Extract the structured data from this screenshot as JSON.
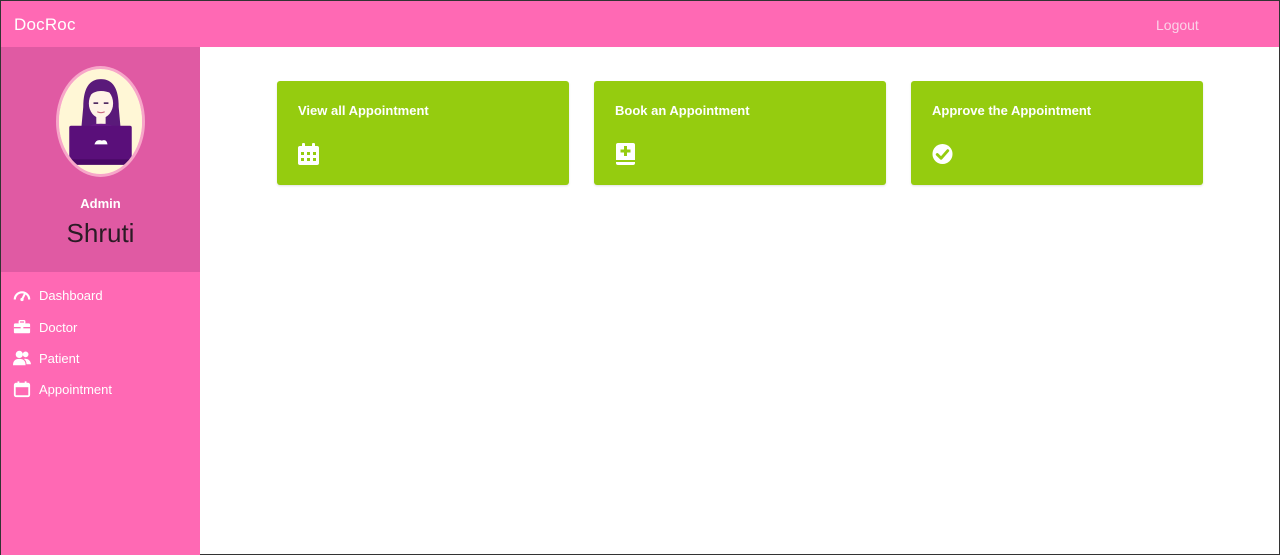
{
  "header": {
    "brand": "DocRoc",
    "logout_label": "Logout"
  },
  "profile": {
    "role": "Admin",
    "name": "Shruti",
    "avatar_icon": "woman-at-laptop-avatar"
  },
  "sidebar": {
    "items": [
      {
        "label": "Dashboard",
        "icon": "speedometer-icon"
      },
      {
        "label": "Doctor",
        "icon": "briefcase-icon"
      },
      {
        "label": "Patient",
        "icon": "users-icon"
      },
      {
        "label": "Appointment",
        "icon": "calendar-icon"
      }
    ]
  },
  "cards": [
    {
      "title": "View all Appointment",
      "icon": "calendar-grid-icon"
    },
    {
      "title": "Book an Appointment",
      "icon": "medical-book-icon"
    },
    {
      "title": "Approve the Appointment",
      "icon": "check-circle-icon"
    }
  ],
  "colors": {
    "header_bg": "#ff69b4",
    "sidebar_bg": "#ff69b4",
    "profile_bg": "#e05aa3",
    "card_bg": "#95cc0f",
    "text_light": "#ffffff"
  }
}
